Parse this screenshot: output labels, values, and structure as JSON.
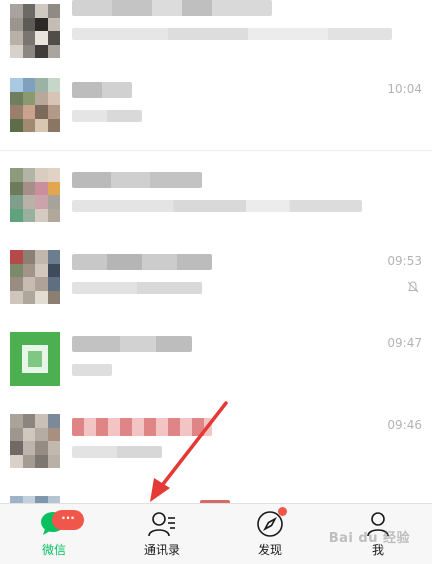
{
  "chats": [
    {
      "time": "",
      "muted": false
    },
    {
      "time": "10:04",
      "muted": false
    },
    {
      "time": "",
      "muted": false
    },
    {
      "time": "09:53",
      "muted": true
    },
    {
      "time": "09:47",
      "muted": false
    },
    {
      "time": "09:46",
      "muted": false
    },
    {
      "time": "",
      "muted": false
    }
  ],
  "tabs": [
    {
      "label": "微信",
      "icon": "chat-bubble-icon",
      "active": true,
      "badge": "···"
    },
    {
      "label": "通讯录",
      "icon": "contacts-icon",
      "active": false
    },
    {
      "label": "发现",
      "icon": "compass-icon",
      "active": false,
      "dot": true
    },
    {
      "label": "我",
      "icon": "person-icon",
      "active": false
    }
  ],
  "watermark": "Bai du 经验",
  "colors": {
    "accent_green": "#07c160",
    "badge_red": "#f1564a",
    "arrow_red": "#e53935",
    "time_gray": "#b3b3b3"
  }
}
